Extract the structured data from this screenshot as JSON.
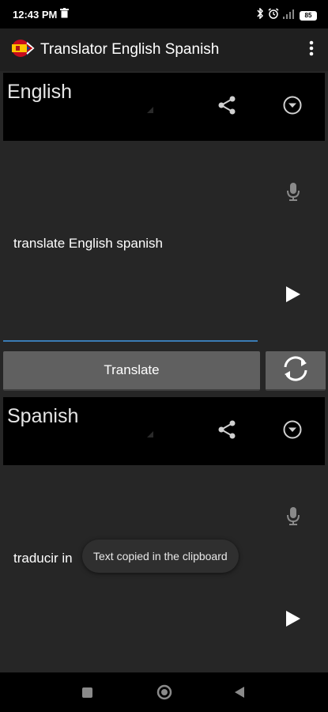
{
  "status_bar": {
    "time": "12:43 PM",
    "battery": "85"
  },
  "app_bar": {
    "title": "Translator English Spanish"
  },
  "source": {
    "language": "English",
    "text": "translate English spanish"
  },
  "translate_label": "Translate",
  "target": {
    "language": "Spanish",
    "text": "traducir in"
  },
  "toast": {
    "message": "Text copied in the clipboard"
  },
  "colors": {
    "background": "#262626",
    "header": "#000000",
    "button": "#606060",
    "accent": "#3a7bb4"
  }
}
